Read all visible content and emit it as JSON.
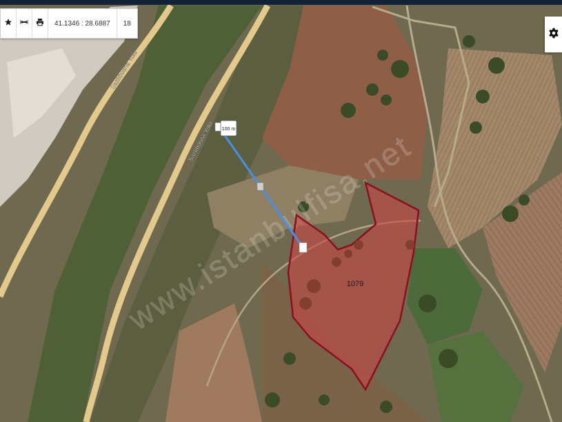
{
  "toolbar": {
    "star_icon": "star-icon",
    "measure_icon": "measure-arrows-icon",
    "print_icon": "printer-icon",
    "coordinates": "41.1346 : 28.6887",
    "zoom": "18"
  },
  "settings": {
    "icon": "gear-icon"
  },
  "map": {
    "parcel_number": "1079",
    "measure_label": "100 m",
    "roads": [
      {
        "name": "Sazlıbosna Yolu"
      },
      {
        "name": "Sazlıbosna Yolu"
      }
    ],
    "watermark": "www.istanbulfisa.net",
    "colors": {
      "parcel_fill": "#c84646",
      "parcel_stroke": "#8b0f20",
      "measure_line": "#4a8fe7",
      "road": "#e3c98b"
    }
  }
}
